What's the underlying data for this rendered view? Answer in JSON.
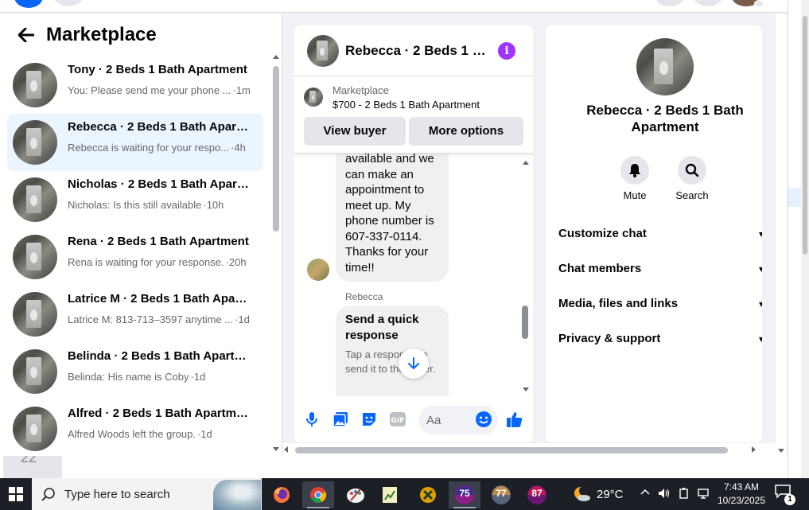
{
  "marketplace": {
    "title": "Marketplace",
    "conversations": [
      {
        "name": "Tony · 2 Beds 1 Bath Apartment",
        "preview": "You: Please send me your phone ...",
        "time": "·1m",
        "active": false
      },
      {
        "name": "Rebecca · 2 Beds 1 Bath Apartm...",
        "preview": "Rebecca is waiting for your respo...",
        "time": "·4h",
        "active": true
      },
      {
        "name": "Nicholas · 2 Beds 1 Bath Apart...",
        "preview": "Nicholas: Is this still available",
        "time": "·10h",
        "active": false
      },
      {
        "name": "Rena · 2 Beds 1 Bath Apartment",
        "preview": "Rena is waiting for your response.",
        "time": "·20h",
        "active": false
      },
      {
        "name": "Latrice M · 2 Beds 1 Bath Apart...",
        "preview": "Latrice M: 813-713–3597 anytime ...",
        "time": "·1d",
        "active": false
      },
      {
        "name": "Belinda · 2 Beds 1 Bath Apartm...",
        "preview": "Belinda: His name is Coby",
        "time": "·1d",
        "active": false
      },
      {
        "name": "Alfred · 2 Beds 1 Bath Apartment",
        "preview": "Alfred Woods left the group.",
        "time": "·1d",
        "active": false
      }
    ]
  },
  "chat": {
    "title": "Rebecca · 2 Beds 1 B...",
    "listing_source": "Marketplace",
    "listing_price": "$700 - 2 Beds 1 Bath Apartment",
    "view_buyer": "View buyer",
    "more_options": "More options",
    "message_lines": [
      "available and we",
      "can make an",
      "appointment to",
      "meet up. My",
      "phone number is",
      "607-337-0114.",
      "Thanks for your",
      "time!!"
    ],
    "sender_name": "Rebecca",
    "quick_title": "Send a quick response",
    "quick_sub": "Tap a response to send it to the buyer.",
    "input_placeholder": "Aa"
  },
  "info": {
    "name": "Rebecca · 2 Beds 1 Bath Apartment",
    "mute": "Mute",
    "search": "Search",
    "menu": [
      "Customize chat",
      "Chat members",
      "Media, files and links",
      "Privacy & support"
    ]
  },
  "taskbar": {
    "search_placeholder": "Type here to search",
    "badges": [
      "75",
      "77",
      "87"
    ],
    "temperature": "29°C",
    "time": "7:43 AM",
    "date": "10/23/2025",
    "notifications": "1"
  },
  "background": {
    "side_number": "22"
  },
  "colors": {
    "accent": "#0866ff",
    "info_purple": "#a033ff",
    "active_row": "#ebf5ff"
  }
}
